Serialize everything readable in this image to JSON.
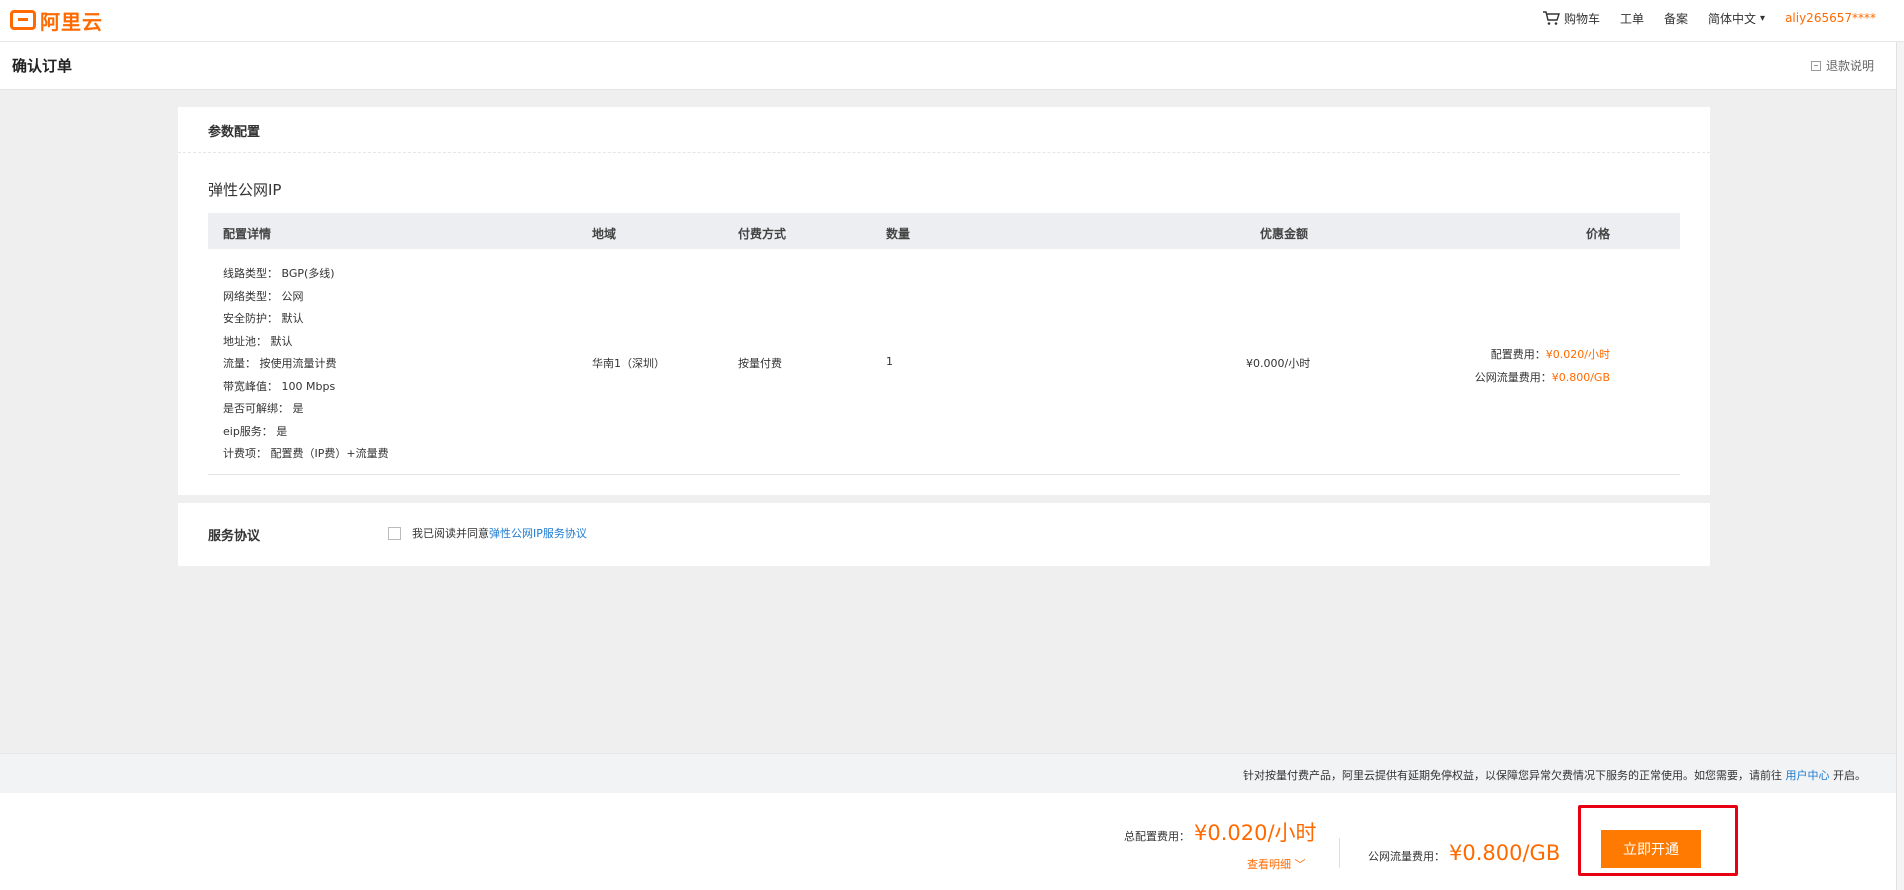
{
  "nav": {
    "logo_text": "阿里云",
    "cart": "购物车",
    "workorder": "工单",
    "filing": "备案",
    "language": "简体中文",
    "user": "aliy265657****"
  },
  "titlebar": {
    "title": "确认订单",
    "refund": "退款说明"
  },
  "config": {
    "section_title": "参数配置",
    "product_name": "弹性公网IP",
    "columns": {
      "details": "配置详情",
      "region": "地域",
      "billing": "付费方式",
      "quantity": "数量",
      "discount": "优惠金额",
      "price": "价格"
    },
    "specs": [
      "线路类型：  BGP(多线)",
      "网络类型：  公网",
      "安全防护：  默认",
      "地址池：  默认",
      "流量：  按使用流量计费",
      "带宽峰值：  100 Mbps",
      "是否可解绑：  是",
      "eip服务：  是",
      "计费项：  配置费（IP费）+流量费"
    ],
    "row": {
      "region": "华南1（深圳）",
      "billing": "按量付费",
      "quantity": "1",
      "discount": "¥0.000/小时",
      "config_fee_label": "配置费用：",
      "config_fee_value": "¥0.020/小时",
      "traffic_fee_label": "公网流量费用：",
      "traffic_fee_value": "¥0.800/GB"
    }
  },
  "service": {
    "title": "服务协议",
    "agree_text": "我已阅读并同意",
    "agreement_link": "弹性公网IP服务协议"
  },
  "notice": {
    "text": "针对按量付费产品，阿里云提供有延期免停权益，以保障您异常欠费情况下服务的正常使用。如您需要，请前往",
    "link": "用户中心",
    "suffix": "开启。"
  },
  "bottom": {
    "total_label": "总配置费用：",
    "total_value": "¥0.020/小时",
    "detail_link": "查看明细",
    "traffic_label": "公网流量费用：",
    "traffic_value": "¥0.800/GB",
    "open_button": "立即开通"
  },
  "colors": {
    "accent": "#ff6a00",
    "link": "#1d7ad1",
    "highlight": "#e60012"
  }
}
